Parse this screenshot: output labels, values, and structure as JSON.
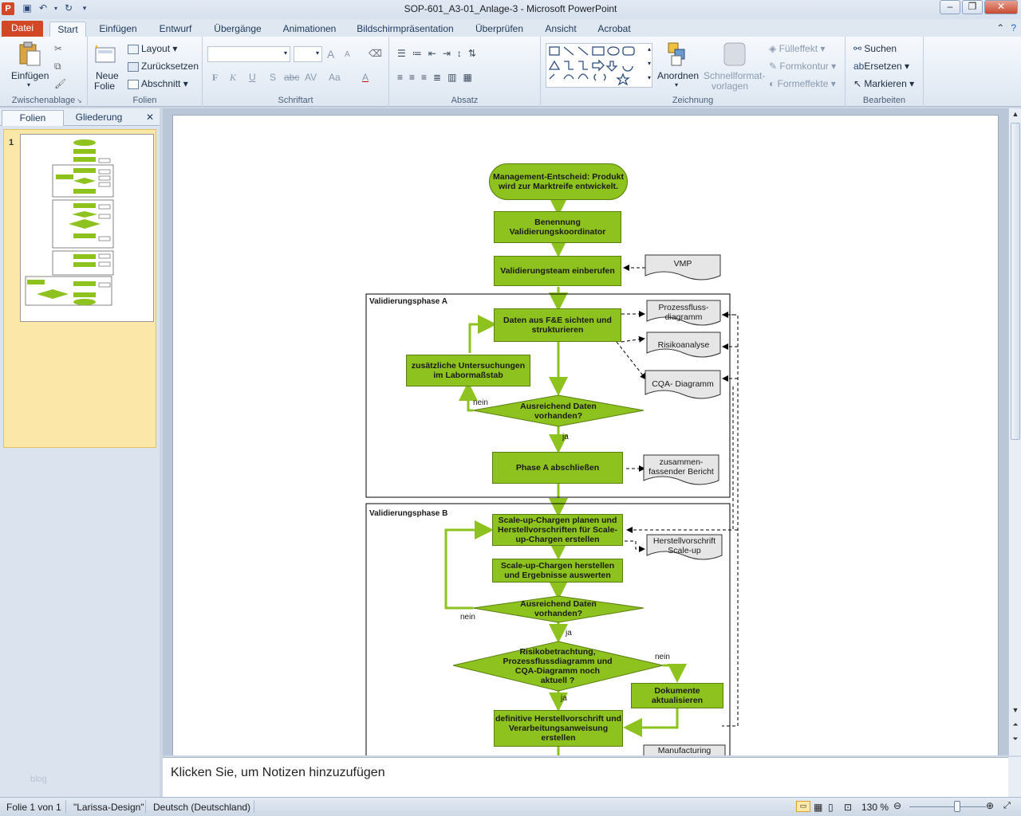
{
  "window": {
    "title": "SOP-601_A3-01_Anlage-3 - Microsoft PowerPoint",
    "app_icon": "P"
  },
  "tabs": {
    "file": "Datei",
    "items": [
      "Start",
      "Einfügen",
      "Entwurf",
      "Übergänge",
      "Animationen",
      "Bildschirmpräsentation",
      "Überprüfen",
      "Ansicht",
      "Acrobat"
    ],
    "active": "Start"
  },
  "ribbon": {
    "clipboard": {
      "label": "Zwischenablage",
      "paste": "Einfügen"
    },
    "slides": {
      "label": "Folien",
      "new_slide_1": "Neue",
      "new_slide_2": "Folie",
      "layout": "Layout",
      "reset": "Zurücksetzen",
      "section": "Abschnitt"
    },
    "font": {
      "label": "Schriftart",
      "bold": "F",
      "italic": "K",
      "underline": "U",
      "shadow": "S",
      "strike": "abc",
      "spacing": "AV",
      "case": "Aa",
      "color": "A",
      "grow": "A",
      "shrink": "A"
    },
    "paragraph": {
      "label": "Absatz"
    },
    "drawing": {
      "label": "Zeichnung",
      "arrange": "Anordnen",
      "quickstyles_1": "Schnellformat-",
      "quickstyles_2": "vorlagen",
      "fill": "Fülleffekt",
      "outline": "Formkontur",
      "effects": "Formeffekte"
    },
    "editing": {
      "label": "Bearbeiten",
      "find": "Suchen",
      "replace": "Ersetzen",
      "select": "Markieren"
    }
  },
  "pane": {
    "tab_slides": "Folien",
    "tab_outline": "Gliederung",
    "slide_number": "1",
    "watermark": "blog"
  },
  "flowchart": {
    "start": "Management-Entscheid: Produkt wird zur Marktreife entwickelt.",
    "step1": "Benennung Validierungskoordinator",
    "step2": "Validierungsteam einberufen",
    "vmp": "VMP",
    "phaseA": "Validierungsphase A",
    "a_data": "Daten aus F&E sichten und strukturieren",
    "doc_flow": "Prozessfluss-diagramm",
    "doc_risk": "Risikoanalyse",
    "doc_cqa": "CQA- Diagramm",
    "a_extra": "zusätzliche Untersuchungen im Labormaßstab",
    "a_decision": "Ausreichend Daten vorhanden?",
    "nein": "nein",
    "ja": "ja",
    "a_close": "Phase A abschließen",
    "doc_summary": "zusammen-fassender Bericht",
    "phaseB": "Validierungsphase B",
    "b_plan": "Scale-up-Chargen planen und Herstellvorschriften für Scale-up-Chargen erstellen",
    "doc_scaleup": "Herstellvorschrift Scale-up",
    "b_make": "Scale-up-Chargen herstellen und Ergebnisse auswerten",
    "b_decision": "Ausreichend Daten vorhanden?",
    "b_risk": "Risikobetrachtung, Prozessflussdiagramm und CQA-Diagramm noch aktuell ?",
    "b_update": "Dokumente aktualisieren",
    "b_final": "definitive Herstellvorschrift und Verarbeitungsanweisung erstellen",
    "doc_manufacturing": "Manufacturing"
  },
  "notes": {
    "placeholder": "Klicken Sie, um Notizen hinzuzufügen"
  },
  "status": {
    "slide": "Folie 1 von 1",
    "design": "\"Larissa-Design\"",
    "language": "Deutsch (Deutschland)",
    "zoom": "130 %",
    "zoom_level": 0.62
  },
  "colors": {
    "accent": "#8dc21f",
    "file_tab": "#d24726"
  }
}
